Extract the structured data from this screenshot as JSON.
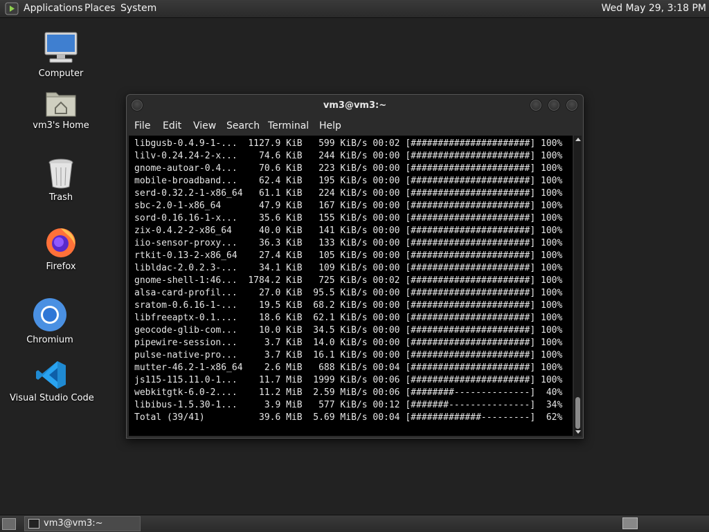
{
  "top_panel": {
    "menus": [
      "Applications",
      "Places",
      "System"
    ],
    "clock": "Wed May 29,  3:18 PM"
  },
  "desktop": {
    "icons": [
      {
        "label": "Computer",
        "icon": "computer-icon"
      },
      {
        "label": "vm3's Home",
        "icon": "home-folder-icon"
      },
      {
        "label": "Trash",
        "icon": "trash-icon"
      },
      {
        "label": "Firefox",
        "icon": "firefox-icon"
      },
      {
        "label": "Chromium",
        "icon": "chromium-icon"
      },
      {
        "label": "Visual Studio Code",
        "icon": "vscode-icon"
      }
    ]
  },
  "terminal": {
    "title": "vm3@vm3:~",
    "menu": [
      "File",
      "Edit",
      "View",
      "Search",
      "Terminal",
      "Help"
    ],
    "lines": [
      "libgusb-0.4.9-1-...  1127.9 KiB   599 KiB/s 00:02 [######################] 100%",
      "lilv-0.24.24-2-x...    74.6 KiB   244 KiB/s 00:00 [######################] 100%",
      "gnome-autoar-0.4...    70.6 KiB   223 KiB/s 00:00 [######################] 100%",
      "mobile-broadband...    62.4 KiB   195 KiB/s 00:00 [######################] 100%",
      "serd-0.32.2-1-x86_64   61.1 KiB   224 KiB/s 00:00 [######################] 100%",
      "sbc-2.0-1-x86_64       47.9 KiB   167 KiB/s 00:00 [######################] 100%",
      "sord-0.16.16-1-x...    35.6 KiB   155 KiB/s 00:00 [######################] 100%",
      "zix-0.4.2-2-x86_64     40.0 KiB   141 KiB/s 00:00 [######################] 100%",
      "iio-sensor-proxy...    36.3 KiB   133 KiB/s 00:00 [######################] 100%",
      "rtkit-0.13-2-x86_64    27.4 KiB   105 KiB/s 00:00 [######################] 100%",
      "libldac-2.0.2.3-...    34.1 KiB   109 KiB/s 00:00 [######################] 100%",
      "gnome-shell-1:46...  1784.2 KiB   725 KiB/s 00:02 [######################] 100%",
      "alsa-card-profil...    27.0 KiB  95.5 KiB/s 00:00 [######################] 100%",
      "sratom-0.6.16-1-...    19.5 KiB  68.2 KiB/s 00:00 [######################] 100%",
      "libfreeaptx-0.1....    18.6 KiB  62.1 KiB/s 00:00 [######################] 100%",
      "geocode-glib-com...    10.0 KiB  34.5 KiB/s 00:00 [######################] 100%",
      "pipewire-session...     3.7 KiB  14.0 KiB/s 00:00 [######################] 100%",
      "pulse-native-pro...     3.7 KiB  16.1 KiB/s 00:00 [######################] 100%",
      "mutter-46.2-1-x86_64    2.6 MiB   688 KiB/s 00:04 [######################] 100%",
      "js115-115.11.0-1...    11.7 MiB  1999 KiB/s 00:06 [######################] 100%",
      "webkitgtk-6.0-2....    11.2 MiB  2.59 MiB/s 00:06 [########--------------]  40%",
      "libibus-1.5.30-1...     3.9 MiB   577 KiB/s 00:12 [#######---------------]  34%",
      "Total (39/41)          39.6 MiB  5.69 MiB/s 00:04 [#############---------]  62%"
    ]
  },
  "taskbar": {
    "task_label": "vm3@vm3:~"
  }
}
